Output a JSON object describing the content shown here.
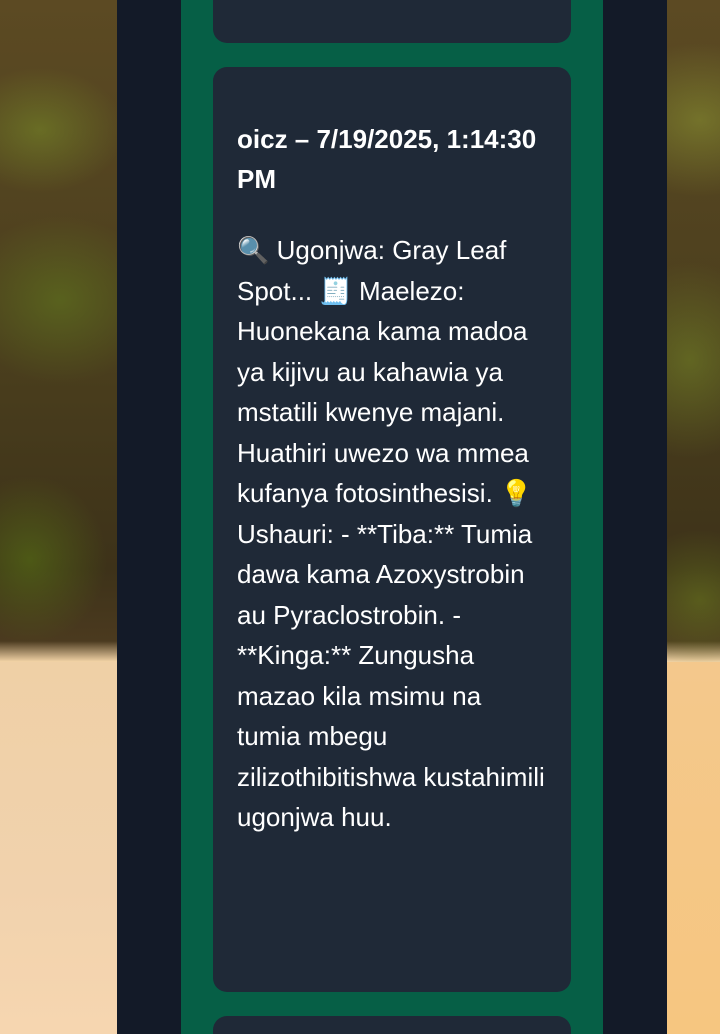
{
  "message": {
    "author": "oicz",
    "separator": " – ",
    "timestamp": "7/19/2025, 1:14:30 PM",
    "header": "oicz – 7/19/2025, 1:14:30 PM",
    "body": "🔍 Ugonjwa: Gray Leaf Spot... 🧾 Maelezo: Huonekana kama madoa ya kijivu au kahawia ya mstatili kwenye majani. Huathiri uwezo wa mmea kufanya fotosinthesisi. 💡 Ushauri: - **Tiba:** Tumia dawa kama Azoxystrobin au Pyraclostrobin. - **Kinga:** Zungusha mazao kila msimu na tumia mbegu zilizothibitishwa kustahimili ugonjwa huu."
  },
  "colors": {
    "outer_column": "#131a28",
    "inner_column": "#065f46",
    "card": "#1f2937",
    "text": "#ffffff"
  }
}
